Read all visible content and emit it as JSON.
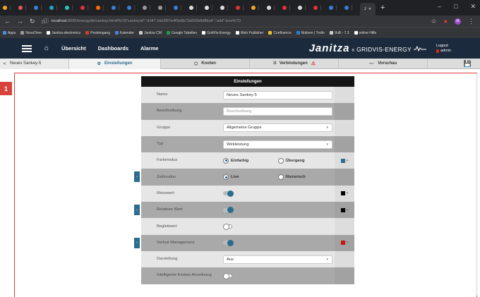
{
  "browser": {
    "url_host": "localhost",
    "url_rest": ":8080/energy/de/sankey.html#%78\"sankeyId\":\"d347 1bb3f97e4f0e8b73a592bfb8fba4\",\"add\":true%7D",
    "active_tab_label": "J",
    "window_controls": [
      "–",
      "□",
      "✕"
    ],
    "profile_initial": "M"
  },
  "bookmarks": [
    {
      "label": "Apps",
      "color": "#4a90d9"
    },
    {
      "label": "NovaTime",
      "color": "#999999"
    },
    {
      "label": "Janitza electronics",
      "color": "#ffffff"
    },
    {
      "label": "Posteingang",
      "color": "#d33b2c"
    },
    {
      "label": "Kalender",
      "color": "#4a7fd6"
    },
    {
      "label": "Janitza CM",
      "color": "#cccccc"
    },
    {
      "label": "Google Tabellen",
      "color": "#1e9e4a"
    },
    {
      "label": "GridVis-Energy",
      "color": "#ffffff"
    },
    {
      "label": "Web Publisher",
      "color": "#ffffff"
    },
    {
      "label": "Confluence",
      "color": "#f2c12e"
    },
    {
      "label": "Notizen | Trello",
      "color": "#2a7fd4"
    },
    {
      "label": "VuB - 7.3",
      "color": "#cccccc"
    },
    {
      "label": "online Hilfe",
      "color": "#ffffff"
    }
  ],
  "appbar": {
    "nav": [
      "Übersicht",
      "Dashboards",
      "Alarme"
    ],
    "brand": "Janitza",
    "brand_sub": "GRIDVIS-ENERGY",
    "logout": "Logout",
    "user": "admin"
  },
  "toolbar": {
    "sankey_name": "Neues Sankey-5",
    "tabs": [
      "Einstellungen",
      "Knoten",
      "Verbindungen",
      "Vorschau"
    ]
  },
  "marker": "1",
  "panel": {
    "title": "Einstellungen",
    "rows": {
      "name": {
        "label": "Name",
        "value": "Neues Sankey-5"
      },
      "beschreibung": {
        "label": "Beschreibung",
        "placeholder": "Beschreibung"
      },
      "gruppe": {
        "label": "Gruppe",
        "value": "Allgemeine Gruppe"
      },
      "typ": {
        "label": "Typ",
        "value": "Wirkleistung"
      },
      "farbmodus": {
        "label": "Farbmodus",
        "option1": "Einfarbig",
        "option2": "Übergang",
        "swatch": "#2c6c8c"
      },
      "zeitmodus": {
        "label": "Zeitmodus",
        "option1": "Live",
        "option2": "Historisch"
      },
      "messwert": {
        "label": "Messwert",
        "swatch": "#000000"
      },
      "relativer": {
        "label": "Relativer Wert",
        "swatch": "#000000"
      },
      "begleitwert": {
        "label": "Begleitwert"
      },
      "verlust": {
        "label": "Verlust Management",
        "swatch": "#cc1111"
      },
      "darstellung": {
        "label": "Darstellung",
        "value": "Aus"
      },
      "knoten": {
        "label": "Intelligente Knoten Anordnung"
      }
    }
  }
}
